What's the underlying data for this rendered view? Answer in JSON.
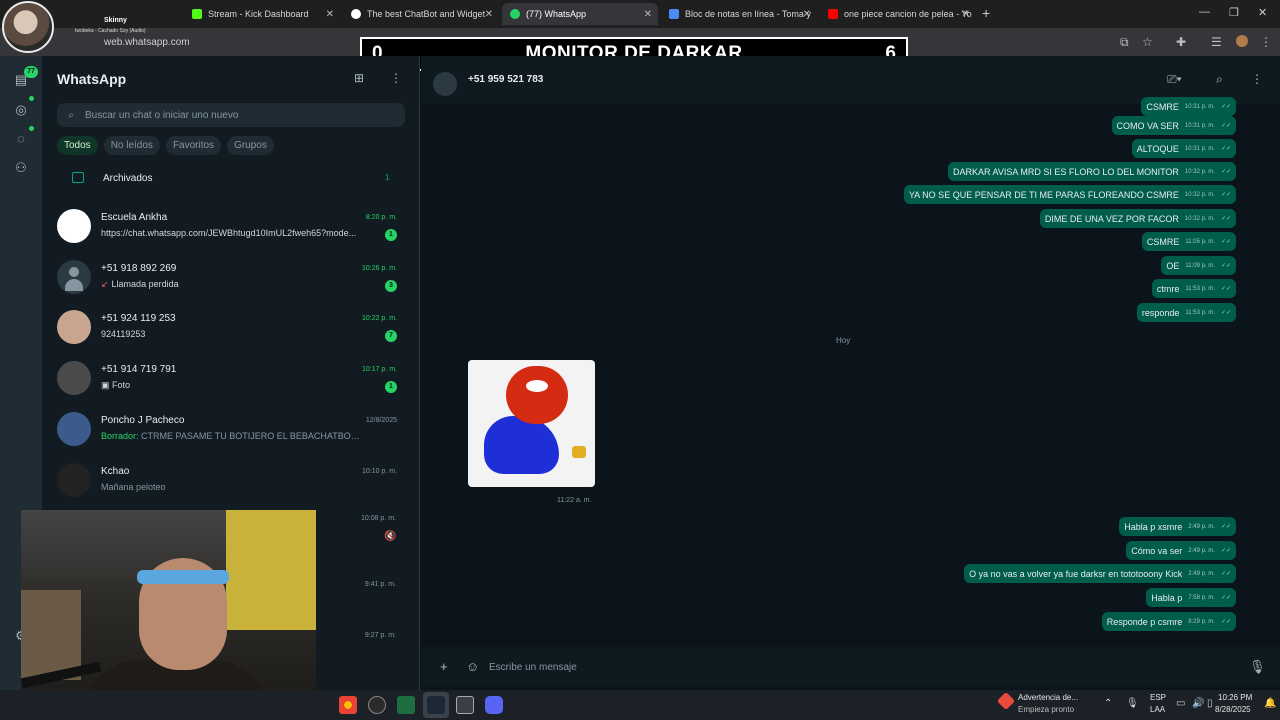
{
  "browser": {
    "tabs": [
      {
        "label": "Stream - Kick Dashboard",
        "color": "#53fc18"
      },
      {
        "label": "The best ChatBot and Widget",
        "color": "#ffffff"
      },
      {
        "label": "(77) WhatsApp",
        "color": "#25d366",
        "active": true
      },
      {
        "label": "Bloc de notas en línea - Toma y",
        "color": "#4b8bf5"
      },
      {
        "label": "one piece cancion de pelea - Yo",
        "color": "#ff0000"
      }
    ],
    "url": "web.whatsapp.com"
  },
  "streamer": {
    "name": "Skinny",
    "subtitle": "Iwobeka - Cachado Soy (Audio)"
  },
  "overlay": {
    "left_score": "0",
    "title": "MONITOR DE DARKAR",
    "right_score": "6"
  },
  "rail": {
    "unread_badge": "77"
  },
  "sidebar": {
    "title": "WhatsApp",
    "search_placeholder": "Buscar un chat o iniciar uno nuevo",
    "filters": [
      "Todos",
      "No leídos",
      "Favoritos",
      "Grupos"
    ],
    "archived": {
      "label": "Archivados",
      "count": "1"
    },
    "chats": [
      {
        "name": "Escuela Ankha",
        "time": "8:20 p. m.",
        "preview": "https://chat.whatsapp.com/JEWBhtugd10ImUL2fweh65?mode...",
        "unread": "1",
        "time_green": true,
        "avatar": "#ffffff"
      },
      {
        "name": "+51 918 892 269",
        "time": "10:26 p. m.",
        "preview": "Llamada perdida",
        "unread": "3",
        "time_green": true,
        "missed": true,
        "avatar": "generic"
      },
      {
        "name": "+51 924 119 253",
        "time": "10:22 p. m.",
        "preview": "924119253",
        "unread": "7",
        "time_green": true,
        "avatar": "#c9a58f"
      },
      {
        "name": "+51 914 719 791",
        "time": "10:17 p. m.",
        "preview": "Foto",
        "unread": "1",
        "time_green": true,
        "photo": true,
        "avatar": "#4a4a4a"
      },
      {
        "name": "Poncho J Pacheco",
        "time": "12/8/2025",
        "draft_label": "Borrador:",
        "preview": "CTRME PASAME TU BOTIJERO EL BEBACHATBOT SU NUME...",
        "avatar": "#3c5a8a"
      },
      {
        "name": "Kchao",
        "time": "10:10 p. m.",
        "preview": "Mañana peloteo",
        "avatar": "#222222"
      }
    ],
    "hidden_times": [
      "10:08 p. m.",
      "9:41 p. m.",
      "9:27 p. m."
    ]
  },
  "conversation": {
    "contact": "+51 959 521 783",
    "day_separator": "Hoy",
    "messages_before": [
      {
        "text": "CSMRE",
        "time": "10:31 p. m."
      },
      {
        "text": "COMO VA SER",
        "time": "10:31 p. m."
      },
      {
        "text": "ALTOQUE",
        "time": "10:31 p. m."
      },
      {
        "text": "DARKAR AVISA MRD SI ES FLORO LO DEL MONITOR",
        "time": "10:32 p. m."
      },
      {
        "text": "YA NO SE QUE PENSAR DE TI ME PARAS FLOREANDO CSMRE",
        "time": "10:32 p. m."
      },
      {
        "text": "DIME DE UNA VEZ POR FACOR",
        "time": "10:32 p. m."
      },
      {
        "text": "CSMRE",
        "time": "11:05 p. m."
      },
      {
        "text": "OE",
        "time": "11:09 p. m."
      },
      {
        "text": "ctmre",
        "time": "11:53 p. m."
      },
      {
        "text": "responde",
        "time": "11:53 p. m."
      }
    ],
    "sticker_time": "11:22 a. m.",
    "messages_after": [
      {
        "text": "Habla p xsmre",
        "time": "2:49 p. m."
      },
      {
        "text": "Cómo va ser",
        "time": "2:49 p. m."
      },
      {
        "text": "O ya no vas a volver ya fue darksr en tototooony Kick",
        "time": "2:49 p. m."
      },
      {
        "text": "Habla p",
        "time": "7:58 p. m."
      },
      {
        "text": "Responde p csmre",
        "time": "8:29 p. m."
      }
    ],
    "compose_placeholder": "Escribe un mensaje"
  },
  "taskbar": {
    "warning_title": "Advertencia de...",
    "warning_sub": "Empieza pronto",
    "lang": "ESP",
    "region": "LAA",
    "time": "10:26 PM",
    "date": "8/28/2025"
  },
  "colors": {
    "accent": "#25d366",
    "bubble_out": "#005c4b",
    "background": "#0b141a"
  }
}
